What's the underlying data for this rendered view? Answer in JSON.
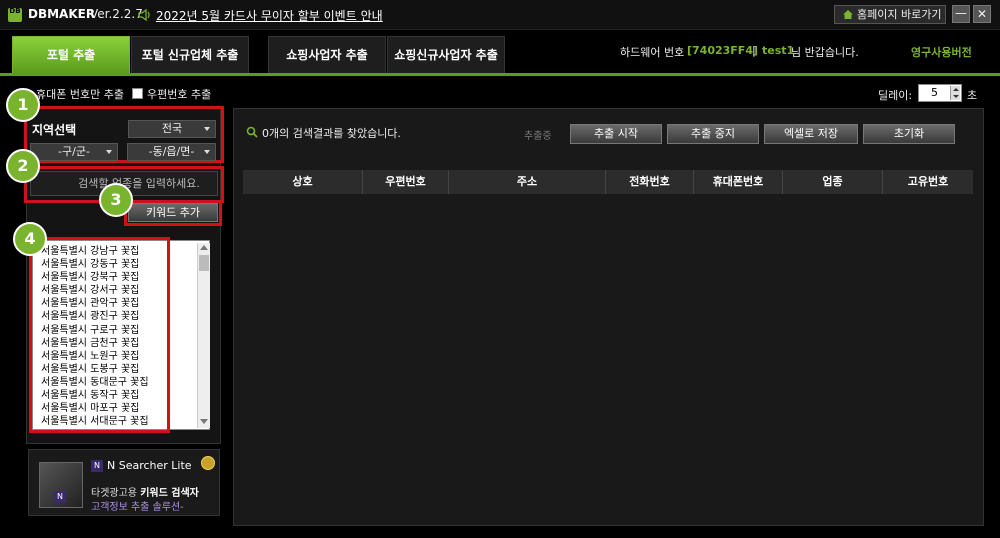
{
  "app": {
    "logo": "DB",
    "name": "DBMAKER",
    "version": "Ver.2.2.7"
  },
  "notice": {
    "icon": "speaker-icon",
    "text": "2022년 5월 카드사 무이자 할부 이벤트 안내"
  },
  "window_controls": {
    "home_label": "홈페이지 바로가기",
    "minimize": "—",
    "close": "✕"
  },
  "tabs": [
    {
      "label": "포털 추출",
      "active": true
    },
    {
      "label": "포털 신규업체 추출",
      "active": false
    },
    {
      "label": "쇼핑사업자 추출",
      "active": false
    },
    {
      "label": "쇼핑신규사업자 추출",
      "active": false
    }
  ],
  "account": {
    "hw_label": "하드웨어 번호",
    "hw_code": "[74023FF4]",
    "separator": "|",
    "user": "test1",
    "greeting": "님 반갑습니다.",
    "license": "영구사용버전"
  },
  "options": {
    "mobile_only": "휴대폰 번호만 추출",
    "postal": "우편번호 추출",
    "delay_label": "딜레이:",
    "delay_value": "5",
    "delay_unit": "초"
  },
  "region": {
    "label": "지역선택",
    "province": "전국",
    "district": "-구/군-",
    "town": "-동/읍/면-"
  },
  "keyword": {
    "placeholder": "검색할 업종을 입력하세요.",
    "add_button": "키워드 추가"
  },
  "badges": [
    "1",
    "2",
    "3",
    "4"
  ],
  "keyword_list": [
    "서울특별시 강남구 꽃집",
    "서울특별시 강동구 꽃집",
    "서울특별시 강북구 꽃집",
    "서울특별시 강서구 꽃집",
    "서울특별시 관악구 꽃집",
    "서울특별시 광진구 꽃집",
    "서울특별시 구로구 꽃집",
    "서울특별시 금천구 꽃집",
    "서울특별시 노원구 꽃집",
    "서울특별시 도봉구 꽃집",
    "서울특별시 동대문구 꽃집",
    "서울특별시 동작구 꽃집",
    "서울특별시 마포구 꽃집",
    "서울특별시 서대문구 꽃집"
  ],
  "ad": {
    "brand": "N Searcher Lite",
    "line1_prefix": "타겟광고용 ",
    "line1_bold": "키워드 검색자",
    "line2": "고객정보 추출 솔루션-"
  },
  "results": {
    "summary": "0개의 검색결과를 찾았습니다.",
    "status": "추출중",
    "buttons": [
      "추출 시작",
      "추출 중지",
      "엑셀로 저장",
      "초기화"
    ],
    "columns": [
      "상호",
      "우편번호",
      "주소",
      "전화번호",
      "휴대폰번호",
      "업종",
      "고유번호"
    ]
  },
  "colors": {
    "accent": "#7ab32e",
    "highlight": "#d0101a"
  }
}
